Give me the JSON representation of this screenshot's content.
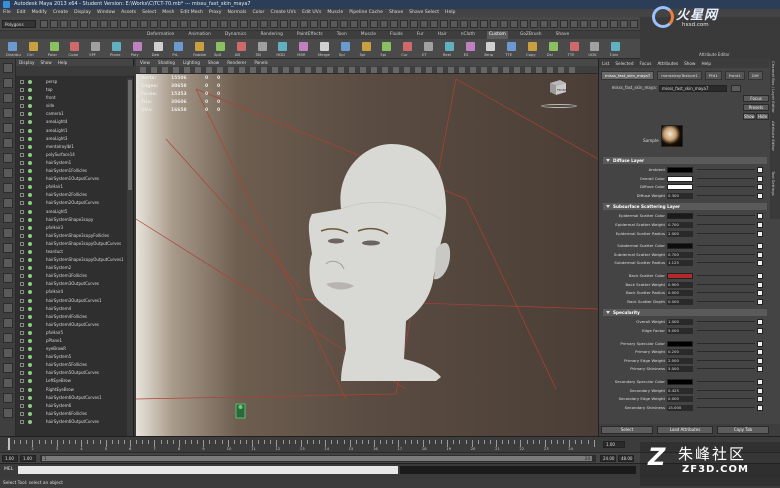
{
  "window": {
    "title": "Autodesk Maya 2013 x64 - Student Version: E:\\Works\\C\\TCT-70.mb*  ---  missu_fast_skin_maya7"
  },
  "menubar": [
    "File",
    "Edit",
    "Modify",
    "Create",
    "Display",
    "Window",
    "Assets",
    "Select",
    "Mesh",
    "Edit Mesh",
    "Proxy",
    "Normals",
    "Color",
    "Create UVs",
    "Edit UVs",
    "Muscle",
    "Pipeline Cache",
    "Shave",
    "Shave Select",
    "Help"
  ],
  "statusline": {
    "mode": "Polygons"
  },
  "shelf": {
    "tabs": [
      "Deformation",
      "Animation",
      "Dynamics",
      "Rendering",
      "PaintEffects",
      "Toon",
      "Muscle",
      "Fluids",
      "Fur",
      "Hair",
      "nCloth",
      "Custom",
      "GoZBrush",
      "Shave"
    ],
    "active_tab": "Custom",
    "labels": [
      "Distribu",
      "Ctrl",
      "Polar",
      "Cube",
      "SPF",
      "Plane",
      "Poly",
      "Deb",
      "PrL",
      "Rubble",
      "Splt",
      "AB",
      "SN",
      "HDD",
      "MSR",
      "Merge",
      "Spl",
      "Spl",
      "Spl",
      "Cur",
      "ET",
      "Reel",
      "ES",
      "Bmp",
      "TTE",
      "Copy",
      "Dsl",
      "TTE",
      "UDK",
      "T-biv"
    ]
  },
  "outliner": {
    "menu": [
      "Display",
      "Show",
      "Help"
    ],
    "items": [
      "persp",
      "top",
      "front",
      "side",
      "camera1",
      "areaLight4",
      "areaLight1",
      "areaLight3",
      "mentalrayIbl1",
      "polySurface14",
      "hairSystem1",
      "hairSystem1Follicles",
      "hairSystem1OutputCurves",
      "pfxHair1",
      "hairSystem2Follicles",
      "hairSystem2OutputCurves",
      "areaLight5",
      "hairSystemShape3copy",
      "pfxHair3",
      "hairSystemShape3copyFollicles",
      "hairSystemShape3copyOutputCurves",
      "tearduct",
      "hairSystemShape3copyOutputCurves1",
      "hairSystem2",
      "hairSystem3Follicles",
      "hairSystem3OutputCurves",
      "pfxHair4",
      "hairSystem3OutputCurves1",
      "hairSystem4",
      "hairSystem4Follicles",
      "hairSystem4OutputCurves",
      "pfxHair5",
      "pPlane1",
      "eyeBrowR",
      "hairSystem5",
      "hairSystem5Follicles",
      "hairSystem5OutputCurves",
      "LeftEyeBrow",
      "RightEyeBrow",
      "hairSystem6OutputCurves1",
      "hairSystem6",
      "hairSystem6Follicles",
      "hairSystem6OutputCurves"
    ]
  },
  "viewport": {
    "menu": [
      "View",
      "Shading",
      "Lighting",
      "Show",
      "Renderer",
      "Panels"
    ],
    "hud": [
      {
        "label": "Verts:",
        "v1": "15506",
        "v2": "0",
        "v3": "0"
      },
      {
        "label": "Edges:",
        "v1": "30658",
        "v2": "0",
        "v3": "0"
      },
      {
        "label": "Faces:",
        "v1": "15353",
        "v2": "0",
        "v3": "0"
      },
      {
        "label": "Tris:",
        "v1": "30606",
        "v2": "0",
        "v3": "0"
      },
      {
        "label": "UVs:",
        "v1": "16658",
        "v2": "0",
        "v3": "0"
      }
    ],
    "viewcube_label": "FRONT",
    "camera_label": "persp"
  },
  "attribute_editor": {
    "tabs": [
      "List",
      "Selected",
      "Focus",
      "Attributes",
      "Show",
      "Help"
    ],
    "nodes": [
      "misss_fast_skin_maya7",
      "mentalrayTexture1",
      "Pfd1",
      "Front1",
      "Diff"
    ],
    "active_node": "misss_fast_skin_maya7",
    "shader_label": "misss_fast_skin_maya:",
    "shader_value": "misss_fast_skin_maya7",
    "buttons": {
      "focus": "Focus",
      "presets": "Presets",
      "show": "Show",
      "hide": "Hide"
    },
    "sample_label": "Sample",
    "vtabs": [
      "Channel Box / Layer Editor",
      "Attribute Editor",
      "Tool Settings"
    ],
    "sections": [
      {
        "title": "Diffuse Layer",
        "rows": [
          {
            "label": "Ambient",
            "type": "color",
            "color": "#000000"
          },
          {
            "label": "Overall Color",
            "type": "color",
            "color": "#ffffff"
          },
          {
            "label": "Diffuse Color",
            "type": "color",
            "color": "#ffffff"
          },
          {
            "label": "Diffuse Weight",
            "type": "num",
            "value": "0.300"
          }
        ]
      },
      {
        "title": "Subsurface Scattering Layer",
        "rows": [
          {
            "label": "Epidermal Scatter Color",
            "type": "color",
            "color": "#1a1a1a"
          },
          {
            "label": "Epidermal Scatter Weight",
            "type": "num",
            "value": "0.700"
          },
          {
            "label": "Epidermal Scatter Radius",
            "type": "num",
            "value": "2.000"
          },
          {
            "label": "Subdermal Scatter Color",
            "type": "color",
            "color": "#0d0d0d"
          },
          {
            "label": "Subdermal Scatter Weight",
            "type": "num",
            "value": "0.700"
          },
          {
            "label": "Subdermal Scatter Radius",
            "type": "num",
            "value": "1.125"
          },
          {
            "label": "Back Scatter Color",
            "type": "color",
            "color": "#b42a2a"
          },
          {
            "label": "Back Scatter Weight",
            "type": "num",
            "value": "0.900"
          },
          {
            "label": "Back Scatter Radius",
            "type": "num",
            "value": "0.000"
          },
          {
            "label": "Back Scatter Depth",
            "type": "num",
            "value": "0.000"
          }
        ]
      },
      {
        "title": "Specularity",
        "rows": [
          {
            "label": "Overall Weight",
            "type": "num",
            "value": "1.000"
          },
          {
            "label": "Edge Factor",
            "type": "num",
            "value": "5.000"
          },
          {
            "label": "Primary Specular Color",
            "type": "color",
            "color": "#000000"
          },
          {
            "label": "Primary Weight",
            "type": "num",
            "value": "0.200"
          },
          {
            "label": "Primary Edge Weight",
            "type": "num",
            "value": "2.000"
          },
          {
            "label": "Primary Shininess",
            "type": "num",
            "value": "5.000"
          },
          {
            "label": "Secondary Specular Color",
            "type": "color",
            "color": "#000000"
          },
          {
            "label": "Secondary Weight",
            "type": "num",
            "value": "0.425"
          },
          {
            "label": "Secondary Edge Weight",
            "type": "num",
            "value": "0.000"
          },
          {
            "label": "Secondary Shininess",
            "type": "num",
            "value": "15.000"
          }
        ]
      }
    ],
    "footer": {
      "select": "Select",
      "load": "Load Attributes",
      "copy": "Copy Tab"
    }
  },
  "timeline": {
    "ticks": [
      "1",
      "2",
      "3",
      "4",
      "5",
      "6",
      "7",
      "8",
      "9",
      "10",
      "11",
      "12",
      "13",
      "14",
      "15",
      "16",
      "17",
      "18",
      "19",
      "20",
      "21",
      "22",
      "23",
      "24"
    ],
    "current": "1.00"
  },
  "range": {
    "start": "1.00",
    "start2": "1.00",
    "current": "1",
    "end": "24",
    "end2": "24.00",
    "end3": "48.00"
  },
  "cmdline": {
    "label": "MEL"
  },
  "helpline": {
    "text": "Select Tool: select an object"
  },
  "watermark_top": {
    "cn": "火星网",
    "en": "hxsd.com"
  },
  "watermark_bottom": {
    "z": "Z",
    "cn": "朱峰社区",
    "en": "ZF3D.COM"
  }
}
